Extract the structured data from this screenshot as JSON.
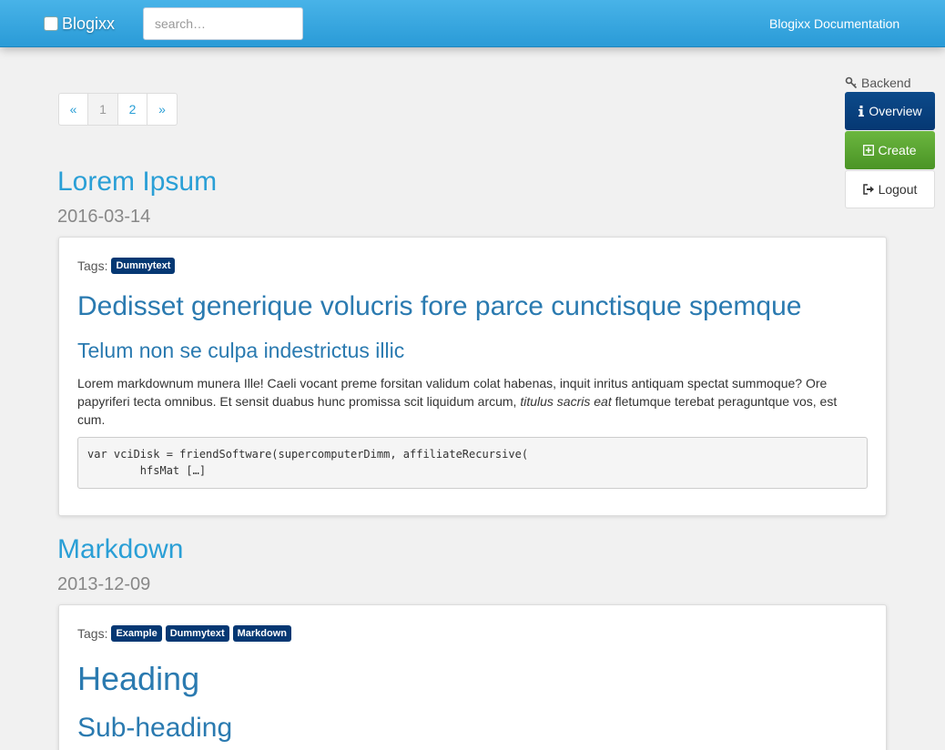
{
  "navbar": {
    "brand": "Blogixx",
    "search_placeholder": "search…",
    "doc_link": "Blogixx Documentation"
  },
  "pagination": {
    "prev": "«",
    "pages": [
      "1",
      "2"
    ],
    "next": "»"
  },
  "sidebar": {
    "heading": "Backend",
    "overview": "Overview",
    "create": "Create",
    "logout": "Logout"
  },
  "posts": [
    {
      "title": "Lorem Ipsum",
      "date": "2016-03-14",
      "tags_label": "Tags:",
      "tags": [
        "Dummytext"
      ],
      "heading1": "Dedisset generique volucris fore parce cunctisque spemque",
      "heading2": "Telum non se culpa indestrictus illic",
      "paragraph_a": "Lorem markdownum munera Ille! Caeli vocant preme forsitan validum colat habenas, inquit inritus antiquam spectat summoque? Ore papyriferi tecta omnibus. Et sensit duabus hunc promissa scit liquidum arcum, ",
      "paragraph_em": "titulus sacris eat",
      "paragraph_b": " fletumque terebat peraguntque vos, est cum.",
      "code": "var vciDisk = friendSoftware(supercomputerDimm, affiliateRecursive(\n        hfsMat […]"
    },
    {
      "title": "Markdown",
      "date": "2013-12-09",
      "tags_label": "Tags:",
      "tags": [
        "Example",
        "Dummytext",
        "Markdown"
      ],
      "heading1": "Heading",
      "heading2": "Sub-heading"
    }
  ],
  "colors": {
    "navbar": "#2a9bd7",
    "link": "#2a9fd6",
    "tag": "#053873",
    "create": "#5aa531"
  }
}
